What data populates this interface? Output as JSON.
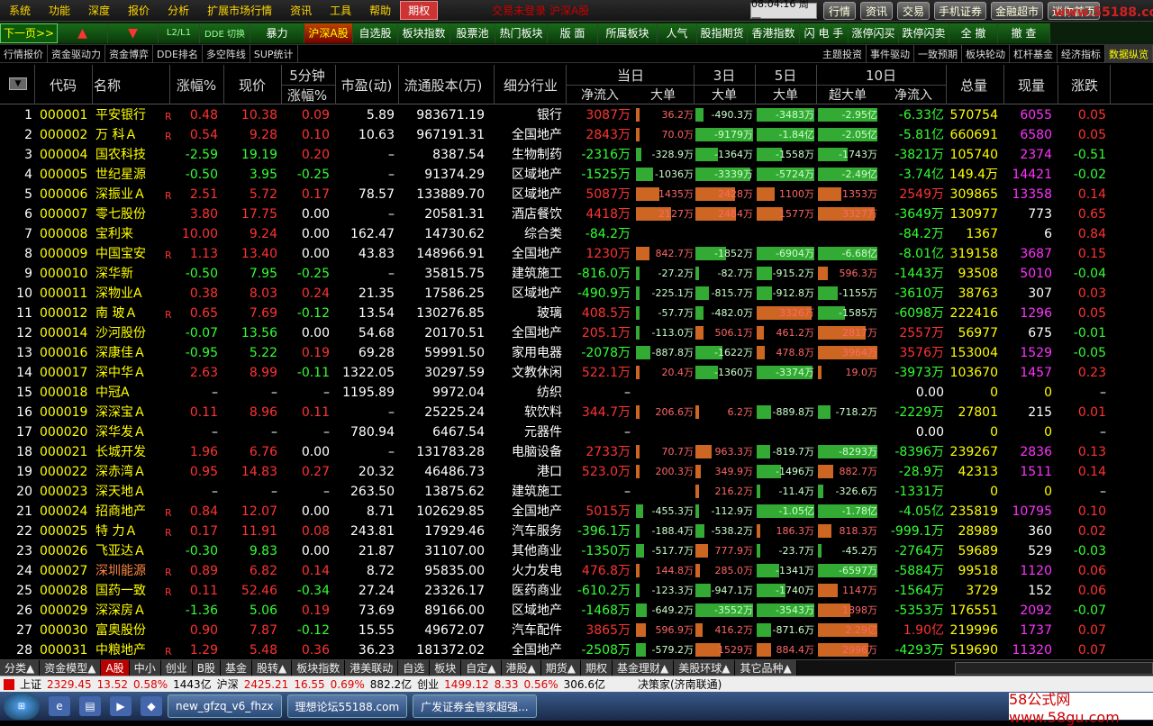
{
  "menu": {
    "items": [
      "系统",
      "功能",
      "深度",
      "报价",
      "分析",
      "扩展市场行情",
      "资讯",
      "工具",
      "帮助"
    ],
    "active": "期权",
    "marquee": "交易未登录  沪深A股",
    "clock": "08:04:16 周一",
    "buttons": [
      "行情",
      "资讯",
      "交易",
      "手机证券",
      "金融超市",
      "迷你首页"
    ],
    "watermark": "www.55188.com"
  },
  "toolbar": {
    "items": [
      "下一页>>",
      "▲",
      "▼",
      "L2/L1",
      "DDE 切换",
      "暴力",
      "沪深A股",
      "自选股",
      "板块指数",
      "股票池",
      "热门板块",
      "版 面",
      "所属板块",
      "人气",
      "股指期货",
      "香港指数",
      "闪 电 手",
      "涨停闪买",
      "跌停闪卖",
      "全 撤",
      "撤 查"
    ]
  },
  "tabs": {
    "left": [
      "行情报价",
      "资金驱动力",
      "资金博弈",
      "DDE排名",
      "多空阵线",
      "SUP统计"
    ],
    "right": [
      "主题投资",
      "事件驱动",
      "一致预期",
      "板块轮动",
      "杠杆基金",
      "经济指标",
      "数据纵览"
    ]
  },
  "columns": {
    "code": "代码",
    "name": "名称",
    "chg": "涨幅%",
    "price": "现价",
    "min5_top": "5分钟",
    "min5_bot": "涨幅%",
    "pe": "市盈(动)",
    "float": "流通股本(万)",
    "industry": "细分行业",
    "today": "当日",
    "day3": "3日",
    "day5": "5日",
    "day10": "10日",
    "netin": "净流入",
    "big": "大单",
    "superbig": "超大单",
    "netin10": "净流入",
    "vol": "总量",
    "cur": "现量",
    "updown": "涨跌"
  },
  "rows": [
    {
      "n": "1",
      "code": "000001",
      "name": "平安银行",
      "r": "R",
      "chg": "0.48",
      "price": "10.38",
      "m5": "0.09",
      "pe": "5.89",
      "fl": "983671.19",
      "ind": "银行",
      "net": "3087万",
      "big": "36.2万",
      "d3": "-490.3万",
      "d5": "-3483万",
      "sb": "-2.95亿",
      "n10": "-6.33亿",
      "vol": "570754",
      "cur": "6055",
      "ud": "0.05"
    },
    {
      "n": "2",
      "code": "000002",
      "name": "万 科Ａ",
      "r": "R",
      "chg": "0.54",
      "price": "9.28",
      "m5": "0.10",
      "pe": "10.63",
      "fl": "967191.31",
      "ind": "全国地产",
      "net": "2843万",
      "big": "70.0万",
      "d3": "-9179万",
      "d5": "-1.84亿",
      "sb": "-2.05亿",
      "n10": "-5.81亿",
      "vol": "660691",
      "cur": "6580",
      "ud": "0.05"
    },
    {
      "n": "3",
      "code": "000004",
      "name": "国农科技",
      "r": "",
      "chg": "-2.59",
      "price": "19.19",
      "m5": "0.20",
      "pe": "–",
      "fl": "8387.54",
      "ind": "生物制药",
      "net": "-2316万",
      "big": "-328.9万",
      "d3": "-1364万",
      "d5": "-1558万",
      "sb": "-1743万",
      "n10": "-3821万",
      "vol": "105740",
      "cur": "2374",
      "ud": "-0.51"
    },
    {
      "n": "4",
      "code": "000005",
      "name": "世纪星源",
      "r": "",
      "chg": "-0.50",
      "price": "3.95",
      "m5": "-0.25",
      "pe": "–",
      "fl": "91374.29",
      "ind": "区域地产",
      "net": "-1525万",
      "big": "-1036万",
      "d3": "-3339万",
      "d5": "-5724万",
      "sb": "-2.49亿",
      "n10": "-3.74亿",
      "vol": "149.4万",
      "cur": "14421",
      "ud": "-0.02"
    },
    {
      "n": "5",
      "code": "000006",
      "name": "深振业Ａ",
      "r": "R",
      "chg": "2.51",
      "price": "5.72",
      "m5": "0.17",
      "pe": "78.57",
      "fl": "133889.70",
      "ind": "区域地产",
      "net": "5087万",
      "big": "1435万",
      "d3": "2428万",
      "d5": "1100万",
      "sb": "1353万",
      "n10": "2549万",
      "vol": "309865",
      "cur": "13358",
      "ud": "0.14"
    },
    {
      "n": "6",
      "code": "000007",
      "name": "零七股份",
      "r": "",
      "chg": "3.80",
      "price": "17.75",
      "m5": "0.00",
      "pe": "–",
      "fl": "20581.31",
      "ind": "酒店餐饮",
      "net": "4418万",
      "big": "2127万",
      "d3": "2484万",
      "d5": "1577万",
      "sb": "3327万",
      "n10": "-3649万",
      "vol": "130977",
      "cur": "773",
      "ud": "0.65"
    },
    {
      "n": "7",
      "code": "000008",
      "name": "宝利来",
      "r": "",
      "chg": "10.00",
      "price": "9.24",
      "m5": "0.00",
      "pe": "162.47",
      "fl": "14730.62",
      "ind": "综合类",
      "net": "-84.2万",
      "big": "",
      "d3": "",
      "d5": "",
      "sb": "",
      "n10": "-84.2万",
      "vol": "1367",
      "cur": "6",
      "ud": "0.84"
    },
    {
      "n": "8",
      "code": "000009",
      "name": "中国宝安",
      "r": "R",
      "chg": "1.13",
      "price": "13.40",
      "m5": "0.00",
      "pe": "43.83",
      "fl": "148966.91",
      "ind": "全国地产",
      "net": "1230万",
      "big": "842.7万",
      "d3": "-1852万",
      "d5": "-6904万",
      "sb": "-6.68亿",
      "n10": "-8.01亿",
      "vol": "319158",
      "cur": "3687",
      "ud": "0.15"
    },
    {
      "n": "9",
      "code": "000010",
      "name": "深华新",
      "r": "",
      "chg": "-0.50",
      "price": "7.95",
      "m5": "-0.25",
      "pe": "–",
      "fl": "35815.75",
      "ind": "建筑施工",
      "net": "-816.0万",
      "big": "-27.2万",
      "d3": "-82.7万",
      "d5": "-915.2万",
      "sb": "596.3万",
      "n10": "-1443万",
      "vol": "93508",
      "cur": "5010",
      "ud": "-0.04"
    },
    {
      "n": "10",
      "code": "000011",
      "name": "深物业A",
      "r": "",
      "chg": "0.38",
      "price": "8.03",
      "m5": "0.24",
      "pe": "21.35",
      "fl": "17586.25",
      "ind": "区域地产",
      "net": "-490.9万",
      "big": "-225.1万",
      "d3": "-815.7万",
      "d5": "-912.8万",
      "sb": "-1155万",
      "n10": "-3610万",
      "vol": "38763",
      "cur": "307",
      "ud": "0.03"
    },
    {
      "n": "11",
      "code": "000012",
      "name": "南 玻Ａ",
      "r": "R",
      "chg": "0.65",
      "price": "7.69",
      "m5": "-0.12",
      "pe": "13.54",
      "fl": "130276.85",
      "ind": "玻璃",
      "net": "408.5万",
      "big": "-57.7万",
      "d3": "-482.0万",
      "d5": "3326万",
      "sb": "-1585万",
      "n10": "-6098万",
      "vol": "222416",
      "cur": "1296",
      "ud": "0.05"
    },
    {
      "n": "12",
      "code": "000014",
      "name": "沙河股份",
      "r": "",
      "chg": "-0.07",
      "price": "13.56",
      "m5": "0.00",
      "pe": "54.68",
      "fl": "20170.51",
      "ind": "全国地产",
      "net": "205.1万",
      "big": "-113.0万",
      "d3": "506.1万",
      "d5": "461.2万",
      "sb": "2817万",
      "n10": "2557万",
      "vol": "56977",
      "cur": "675",
      "ud": "-0.01"
    },
    {
      "n": "13",
      "code": "000016",
      "name": "深康佳Ａ",
      "r": "",
      "chg": "-0.95",
      "price": "5.22",
      "m5": "0.19",
      "pe": "69.28",
      "fl": "59991.50",
      "ind": "家用电器",
      "net": "-2078万",
      "big": "-887.8万",
      "d3": "-1622万",
      "d5": "478.8万",
      "sb": "3964万",
      "n10": "3576万",
      "vol": "153004",
      "cur": "1529",
      "ud": "-0.05"
    },
    {
      "n": "14",
      "code": "000017",
      "name": "深中华Ａ",
      "r": "",
      "chg": "2.63",
      "price": "8.99",
      "m5": "-0.11",
      "pe": "1322.05",
      "fl": "30297.59",
      "ind": "文教休闲",
      "net": "522.1万",
      "big": "20.4万",
      "d3": "-1360万",
      "d5": "-3374万",
      "sb": "19.0万",
      "n10": "-3973万",
      "vol": "103670",
      "cur": "1457",
      "ud": "0.23"
    },
    {
      "n": "15",
      "code": "000018",
      "name": "中冠A",
      "r": "",
      "chg": "–",
      "price": "–",
      "m5": "–",
      "pe": "1195.89",
      "fl": "9972.04",
      "ind": "纺织",
      "net": "–",
      "big": "",
      "d3": "",
      "d5": "",
      "sb": "",
      "n10": "0.00",
      "vol": "0",
      "cur": "0",
      "ud": "–"
    },
    {
      "n": "16",
      "code": "000019",
      "name": "深深宝Ａ",
      "r": "",
      "chg": "0.11",
      "price": "8.96",
      "m5": "0.11",
      "pe": "–",
      "fl": "25225.24",
      "ind": "软饮料",
      "net": "344.7万",
      "big": "206.6万",
      "d3": "6.2万",
      "d5": "-889.8万",
      "sb": "-718.2万",
      "n10": "-2229万",
      "vol": "27801",
      "cur": "215",
      "ud": "0.01"
    },
    {
      "n": "17",
      "code": "000020",
      "name": "深华发Ａ",
      "r": "",
      "chg": "–",
      "price": "–",
      "m5": "–",
      "pe": "780.94",
      "fl": "6467.54",
      "ind": "元器件",
      "net": "–",
      "big": "",
      "d3": "",
      "d5": "",
      "sb": "",
      "n10": "0.00",
      "vol": "0",
      "cur": "0",
      "ud": "–"
    },
    {
      "n": "18",
      "code": "000021",
      "name": "长城开发",
      "r": "",
      "chg": "1.96",
      "price": "6.76",
      "m5": "0.00",
      "pe": "–",
      "fl": "131783.28",
      "ind": "电脑设备",
      "net": "2733万",
      "big": "70.7万",
      "d3": "963.3万",
      "d5": "-819.7万",
      "sb": "-8293万",
      "n10": "-8396万",
      "vol": "239267",
      "cur": "2836",
      "ud": "0.13"
    },
    {
      "n": "19",
      "code": "000022",
      "name": "深赤湾Ａ",
      "r": "",
      "chg": "0.95",
      "price": "14.83",
      "m5": "0.27",
      "pe": "20.32",
      "fl": "46486.73",
      "ind": "港口",
      "net": "523.0万",
      "big": "200.3万",
      "d3": "349.9万",
      "d5": "-1496万",
      "sb": "882.7万",
      "n10": "-28.9万",
      "vol": "42313",
      "cur": "1511",
      "ud": "0.14"
    },
    {
      "n": "20",
      "code": "000023",
      "name": "深天地Ａ",
      "r": "",
      "chg": "–",
      "price": "–",
      "m5": "–",
      "pe": "263.50",
      "fl": "13875.62",
      "ind": "建筑施工",
      "net": "–",
      "big": "",
      "d3": "216.2万",
      "d5": "-11.4万",
      "sb": "-326.6万",
      "n10": "-1331万",
      "vol": "0",
      "cur": "0",
      "ud": "–"
    },
    {
      "n": "21",
      "code": "000024",
      "name": "招商地产",
      "r": "R",
      "chg": "0.84",
      "price": "12.07",
      "m5": "0.00",
      "pe": "8.71",
      "fl": "102629.85",
      "ind": "全国地产",
      "net": "5015万",
      "big": "-455.3万",
      "d3": "-112.9万",
      "d5": "-1.05亿",
      "sb": "-1.78亿",
      "n10": "-4.05亿",
      "vol": "235819",
      "cur": "10795",
      "ud": "0.10"
    },
    {
      "n": "22",
      "code": "000025",
      "name": "特 力Ａ",
      "r": "R",
      "chg": "0.17",
      "price": "11.91",
      "m5": "0.08",
      "pe": "243.81",
      "fl": "17929.46",
      "ind": "汽车服务",
      "net": "-396.1万",
      "big": "-188.4万",
      "d3": "-538.2万",
      "d5": "186.3万",
      "sb": "818.3万",
      "n10": "-999.1万",
      "vol": "28989",
      "cur": "360",
      "ud": "0.02"
    },
    {
      "n": "23",
      "code": "000026",
      "name": "飞亚达Ａ",
      "r": "",
      "chg": "-0.30",
      "price": "9.83",
      "m5": "0.00",
      "pe": "21.87",
      "fl": "31107.00",
      "ind": "其他商业",
      "net": "-1350万",
      "big": "-517.7万",
      "d3": "777.9万",
      "d5": "-23.7万",
      "sb": "-45.2万",
      "n10": "-2764万",
      "vol": "59689",
      "cur": "529",
      "ud": "-0.03"
    },
    {
      "n": "24",
      "code": "000027",
      "name": "深圳能源",
      "r": "R",
      "chg": "0.89",
      "price": "6.82",
      "m5": "0.14",
      "pe": "8.72",
      "fl": "95835.00",
      "ind": "火力发电",
      "net": "476.8万",
      "big": "144.8万",
      "d3": "285.0万",
      "d5": "-1341万",
      "sb": "-6597万",
      "n10": "-5884万",
      "vol": "99518",
      "cur": "1120",
      "ud": "0.06"
    },
    {
      "n": "25",
      "code": "000028",
      "name": "国药一致",
      "r": "R",
      "chg": "0.11",
      "price": "52.46",
      "m5": "-0.34",
      "pe": "27.24",
      "fl": "23326.17",
      "ind": "医药商业",
      "net": "-610.2万",
      "big": "-123.3万",
      "d3": "-947.1万",
      "d5": "-1740万",
      "sb": "1147万",
      "n10": "-1564万",
      "vol": "3729",
      "cur": "152",
      "ud": "0.06"
    },
    {
      "n": "26",
      "code": "000029",
      "name": "深深房Ａ",
      "r": "",
      "chg": "-1.36",
      "price": "5.06",
      "m5": "0.19",
      "pe": "73.69",
      "fl": "89166.00",
      "ind": "区域地产",
      "net": "-1468万",
      "big": "-649.2万",
      "d3": "-3552万",
      "d5": "-3543万",
      "sb": "1898万",
      "n10": "-5353万",
      "vol": "176551",
      "cur": "2092",
      "ud": "-0.07"
    },
    {
      "n": "27",
      "code": "000030",
      "name": "富奥股份",
      "r": "",
      "chg": "0.90",
      "price": "7.87",
      "m5": "-0.12",
      "pe": "15.55",
      "fl": "49672.07",
      "ind": "汽车配件",
      "net": "3865万",
      "big": "596.9万",
      "d3": "416.2万",
      "d5": "-871.6万",
      "sb": "2.29亿",
      "n10": "1.90亿",
      "vol": "219996",
      "cur": "1737",
      "ud": "0.07"
    },
    {
      "n": "28",
      "code": "000031",
      "name": "中粮地产",
      "r": "R",
      "chg": "1.29",
      "price": "5.48",
      "m5": "0.36",
      "pe": "36.23",
      "fl": "181372.02",
      "ind": "全国地产",
      "net": "-2508万",
      "big": "-579.2万",
      "d3": "1529万",
      "d5": "884.4万",
      "sb": "2996万",
      "n10": "-4293万",
      "vol": "519690",
      "cur": "11320",
      "ud": "0.07"
    }
  ],
  "bottom_tabs": [
    "分类▲",
    "资金模型▲",
    "A股",
    "中小",
    "创业",
    "B股",
    "基金",
    "股转▲",
    "板块指数",
    "港美联动",
    "自选",
    "板块",
    "自定▲",
    "港股▲",
    "期货▲",
    "期权",
    "基金理财▲",
    "美股环球▲",
    "其它品种▲"
  ],
  "status": {
    "sh_label": "上证",
    "sh_val": "2329.45",
    "sh_chg": "13.52",
    "sh_pct": "0.58%",
    "sh_amt": "1443亿",
    "sz_label": "沪深",
    "sz_val": "2425.21",
    "sz_chg": "16.55",
    "sz_pct": "0.69%",
    "sz_amt": "882.2亿",
    "cy_label": "创业",
    "cy_val": "1499.12",
    "cy_chg": "8.33",
    "cy_pct": "0.56%",
    "cy_amt": "306.6亿",
    "broker": "决策家(济南联通)"
  },
  "taskbar": {
    "tasks": [
      "new_gfzq_v6_fhzx",
      "理想论坛55188.com",
      "广发证券金管家超强..."
    ],
    "logo": "58公式网 www.58gu.com"
  }
}
